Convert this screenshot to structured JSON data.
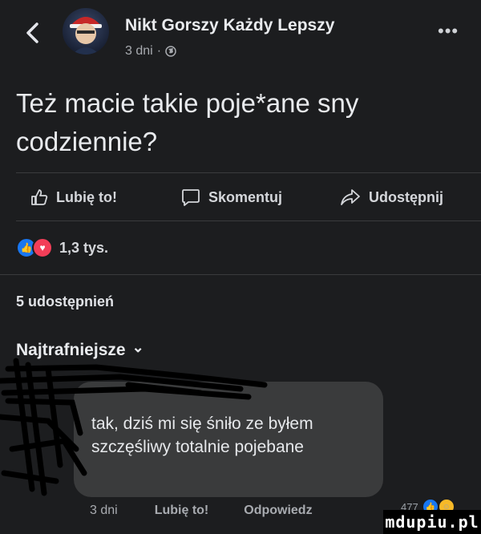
{
  "post": {
    "author": "Nikt Gorszy Każdy Lepszy",
    "time": "3 dni",
    "separator": "·",
    "text": "Też macie takie poje*ane sny codziennie?"
  },
  "actions": {
    "like": "Lubię to!",
    "comment": "Skomentuj",
    "share": "Udostępnij"
  },
  "reactions": {
    "count": "1,3 tys."
  },
  "shares": "5 udostępnień",
  "sort": {
    "label": "Najtrafniejsze",
    "chevron": "⌄"
  },
  "comment": {
    "text": "tak, dziś mi się śniło ze byłem szczęśliwy totalnie pojebane",
    "time": "3 dni",
    "like": "Lubię to!",
    "reply": "Odpowiedz",
    "reaction_count": "477"
  },
  "watermark": "mdupiu.pl",
  "colors": {
    "background": "#1c1d1f",
    "bubble": "#3a3b3c",
    "like_blue": "#1877f2",
    "love_red": "#f33e58"
  }
}
